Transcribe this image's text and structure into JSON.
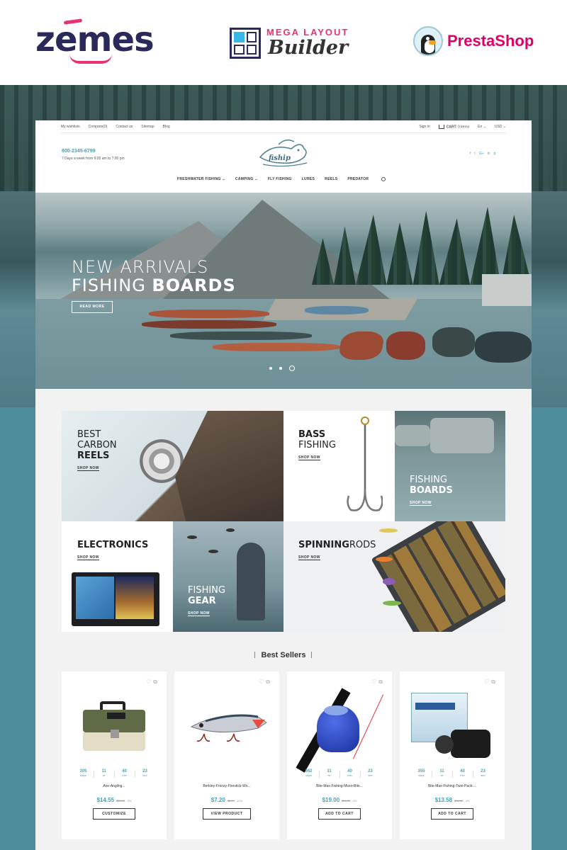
{
  "promo": {
    "zemes": "zemes",
    "mega_layout": "MEGA LAYOUT",
    "builder": "Builder",
    "prestashop": "PrestaShop"
  },
  "topbar": {
    "left_links": [
      "My wishlists",
      "Compare(0)",
      "Contact us",
      "Sitemap",
      "Blog"
    ],
    "signin": "Sign in",
    "cart_label": "CART:",
    "cart_count": "0 items",
    "language": "En",
    "currency": "USD"
  },
  "header": {
    "phone": "800-2345-6799",
    "hours": "7 Days a week from 9:00 am to 7:00 pm",
    "logo_text": "fiship",
    "socials": [
      "f",
      "t",
      "G+",
      "in",
      "p"
    ]
  },
  "nav": {
    "items": [
      "FRESHWATER FISHING",
      "CAMPING",
      "FLY FISHING",
      "LURES",
      "REELS",
      "PREDATOR"
    ]
  },
  "hero": {
    "line1": "NEW ARRIVALS",
    "line2_light": "FISHING ",
    "line2_bold": "BOARDS",
    "button": "READ MORE",
    "slides": 3,
    "active_slide": 3
  },
  "tiles": {
    "reels": {
      "light1": "BEST",
      "light2": "CARBON",
      "bold": "REELS",
      "shop": "SHOP NOW"
    },
    "bass": {
      "bold": "BASS",
      "light": "FISHING",
      "shop": "SHOP NOW"
    },
    "boards": {
      "light": "FISHING",
      "bold": "BOARDS",
      "shop": "SHOP NOW"
    },
    "electronics": {
      "bold": "ELECTRONICS",
      "shop": "SHOP NOW"
    },
    "gear": {
      "light": "FISHING",
      "bold": "GEAR",
      "shop": "SHOP NOW"
    },
    "spinning": {
      "bold": "SPINNING",
      "light": "RODS",
      "shop": "SHOP NOW"
    }
  },
  "best_sellers": {
    "title": "Best Sellers",
    "countdown_labels": [
      "days",
      "hr",
      "min",
      "sec"
    ],
    "products": [
      {
        "name": "Ace-Angling...",
        "price": "$14.55",
        "old_price": "$15.00",
        "discount": "-3%",
        "button": "CUSTOMIZE",
        "countdown": [
          "305",
          "11",
          "40",
          "23"
        ],
        "icon": "tackle-box"
      },
      {
        "name": "Berkley-Frenzy-Firestick-Wo...",
        "price": "$7.20",
        "old_price": "$8.00",
        "discount": "-10%",
        "button": "VIEW PRODUCT",
        "countdown": null,
        "icon": "fishing-lure"
      },
      {
        "name": "Bite-Max-Fishing-Micro-Bite...",
        "price": "$19.00",
        "old_price": "$20.00",
        "discount": "-5%",
        "button": "ADD TO CART",
        "countdown": [
          "362",
          "11",
          "40",
          "23"
        ],
        "icon": "bite-alarm"
      },
      {
        "name": "Bite-Max-Fishing-Twin-Pack-...",
        "price": "$13.58",
        "old_price": "$14.00",
        "discount": "-3%",
        "button": "ADD TO CART",
        "countdown": [
          "355",
          "11",
          "40",
          "23"
        ],
        "icon": "bite-alarm-box"
      }
    ]
  },
  "colors": {
    "accent": "#4aa0b4",
    "zemes_pink": "#e8336f",
    "prestashop_pink": "#df0067",
    "page_bg": "#4e8e9c"
  }
}
